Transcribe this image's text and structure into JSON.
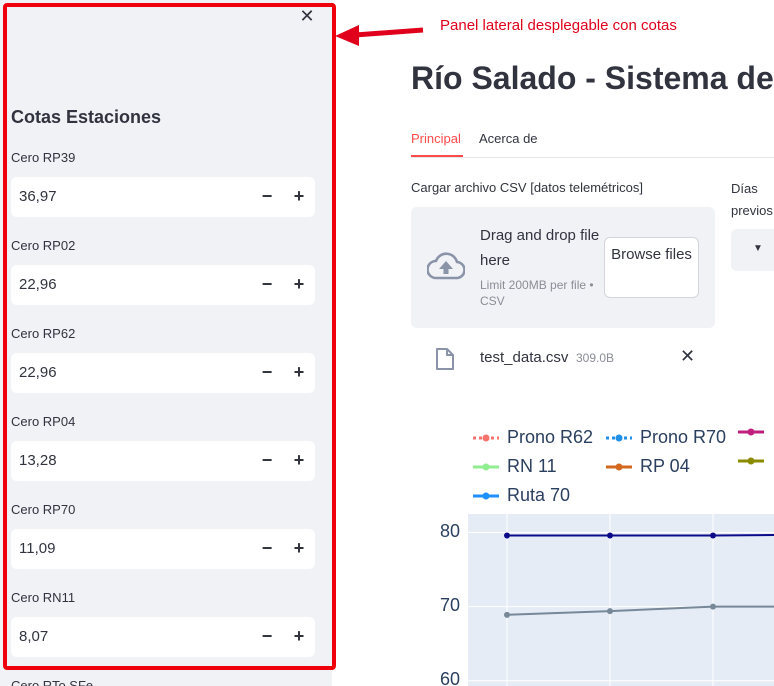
{
  "annotation": {
    "text": "Panel lateral desplegable con cotas"
  },
  "sidebar": {
    "close_icon": "close-icon",
    "title": "Cotas Estaciones",
    "fields": [
      {
        "label": "Cero RP39",
        "value": "36,97"
      },
      {
        "label": "Cero RP02",
        "value": "22,96"
      },
      {
        "label": "Cero RP62",
        "value": "22,96"
      },
      {
        "label": "Cero RP04",
        "value": "13,28"
      },
      {
        "label": "Cero RP70",
        "value": "11,09"
      },
      {
        "label": "Cero RN11",
        "value": "8,07"
      },
      {
        "label": "Cero RTo SFe",
        "value": ""
      }
    ],
    "minus": "−",
    "plus": "+"
  },
  "main": {
    "title": "Río Salado - Sistema de Alerta",
    "tabs": [
      {
        "label": "Principal",
        "active": true
      },
      {
        "label": "Acerca de",
        "active": false
      }
    ],
    "upload": {
      "label": "Cargar archivo CSV [datos telemétricos]",
      "drag_text": "Drag and drop file here",
      "limit_text": "Limit 200MB per file • CSV",
      "browse_label": "Browse files"
    },
    "days": {
      "label": "Días previos"
    },
    "file": {
      "name": "test_data.csv",
      "size": "309.0B"
    }
  },
  "chart_data": {
    "type": "line",
    "legend": [
      {
        "name": "Prono R62",
        "color": "#f4736c",
        "dash": "dot"
      },
      {
        "name": "Prono R70",
        "color": "#1f8fe8",
        "dash": "dot"
      },
      {
        "name": "",
        "color": "#c01f7e",
        "dash": "solid"
      },
      {
        "name": "RN 11",
        "color": "#90ee90",
        "dash": "solid"
      },
      {
        "name": "RP 04",
        "color": "#d2691e",
        "dash": "solid"
      },
      {
        "name": "",
        "color": "#8b8b00",
        "dash": "solid"
      },
      {
        "name": "Ruta 70",
        "color": "#1e90ff",
        "dash": "solid"
      }
    ],
    "yticks": [
      "80",
      "70",
      "60"
    ],
    "ylim": [
      59.3,
      82.5
    ],
    "x": [
      0,
      1,
      2,
      3
    ],
    "series": [
      {
        "color": "#0b0b8a",
        "values": [
          79.6,
          79.6,
          79.6,
          79.7
        ]
      },
      {
        "color": "#778899",
        "values": [
          68.9,
          69.4,
          70.0,
          70.0
        ]
      }
    ]
  }
}
